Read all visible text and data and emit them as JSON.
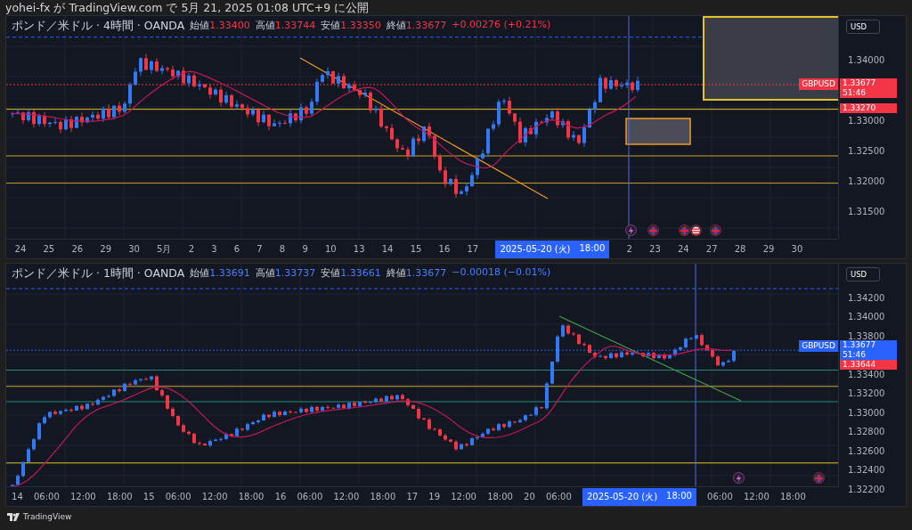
{
  "header": {
    "text": "yohei-fx が TradingView.com で 5月 21, 2025 01:08 UTC+9 に公開"
  },
  "panels": [
    {
      "legend": {
        "symbol": "ポンド／米ドル · 4時間 · OANDA",
        "color": "#f23645",
        "fields": [
          {
            "label": "始値",
            "value": "1.33400"
          },
          {
            "label": "高値",
            "value": "1.33744"
          },
          {
            "label": "安値",
            "value": "1.33350"
          },
          {
            "label": "終値",
            "value": "1.33677"
          }
        ],
        "change": "+0.00276 (+0.21%)"
      },
      "currency": "USD",
      "price_ticks": [
        "1.34000",
        "1.33000",
        "1.32500",
        "1.32000",
        "1.31500"
      ],
      "symbol_tag": {
        "symbol": "GBPUSD",
        "price": "1.33677",
        "countdown": "51:46",
        "color": "#f23645"
      },
      "level_tag": {
        "price": "1.33270",
        "color": "#f23645"
      },
      "time_axis": {
        "labels_before": [
          "24",
          "25",
          "26",
          "29",
          "30",
          "5月",
          "2",
          "3",
          "6",
          "7",
          "8",
          "9",
          "10",
          "13",
          "14",
          "15",
          "16",
          "17"
        ],
        "crosshair_date": "2025-05-20 (火)",
        "crosshair_time": "18:00",
        "labels_after": [
          "2",
          "23",
          "24",
          "27",
          "28",
          "29",
          "30"
        ]
      }
    },
    {
      "legend": {
        "symbol": "ポンド／米ドル · 1時間 · OANDA",
        "color": "#4c7dff",
        "fields": [
          {
            "label": "始値",
            "value": "1.33691"
          },
          {
            "label": "高値",
            "value": "1.33737"
          },
          {
            "label": "安値",
            "value": "1.33661"
          },
          {
            "label": "終値",
            "value": "1.33677"
          }
        ],
        "change": "−0.00018 (−0.01%)"
      },
      "currency": "USD",
      "price_ticks": [
        "1.34200",
        "1.34000",
        "1.33800",
        "1.33400",
        "1.33200",
        "1.33000",
        "1.32800",
        "1.32600",
        "1.32400",
        "1.32200"
      ],
      "symbol_tag": {
        "symbol": "GBPUSD",
        "price": "1.33677",
        "countdown": "51:46",
        "color": "#2962ff"
      },
      "level_tag": {
        "price": "1.33644",
        "color": "#f23645"
      },
      "time_axis": {
        "labels_before": [
          "14",
          "06:00",
          "12:00",
          "18:00",
          "15",
          "06:00",
          "12:00",
          "18:00",
          "16",
          "06:00",
          "12:00",
          "18:00",
          "17",
          "19",
          "12:00",
          "18:00",
          "20",
          "06:00"
        ],
        "crosshair_date": "2025-05-20 (火)",
        "crosshair_time": "18:00",
        "labels_after": [
          "06:00",
          "12:00",
          "18:00"
        ]
      }
    }
  ],
  "footer": {
    "brand": "TradingView"
  }
}
